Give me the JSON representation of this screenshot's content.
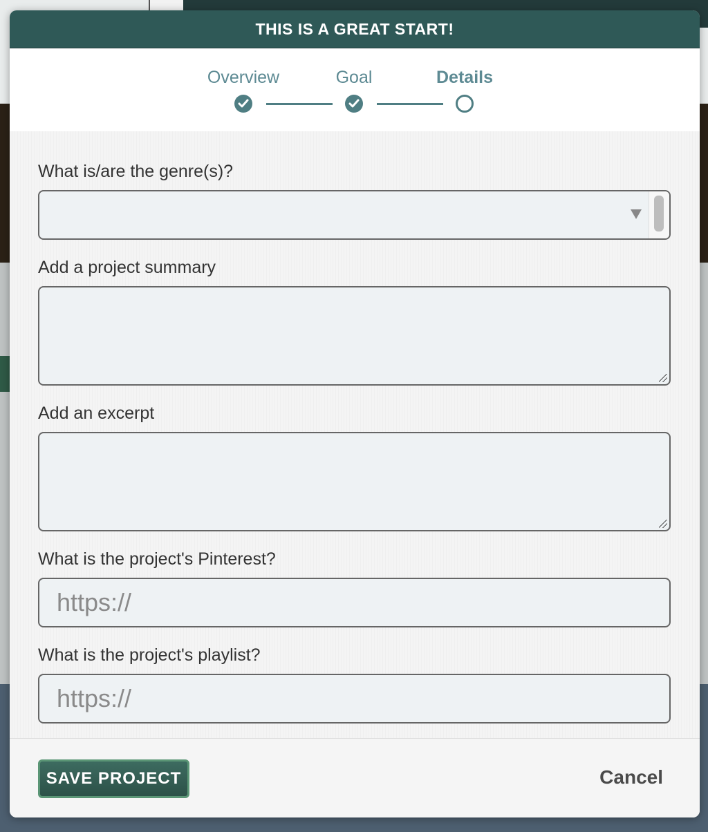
{
  "modal": {
    "title": "THIS IS A GREAT START!"
  },
  "stepper": {
    "steps": [
      {
        "label": "Overview",
        "state": "done"
      },
      {
        "label": "Goal",
        "state": "done"
      },
      {
        "label": "Details",
        "state": "current"
      }
    ]
  },
  "form": {
    "genre_label": "What is/are the genre(s)?",
    "genre_value": "",
    "summary_label": "Add a project summary",
    "summary_value": "",
    "excerpt_label": "Add an excerpt",
    "excerpt_value": "",
    "pinterest_label": "What is the project's Pinterest?",
    "pinterest_placeholder": "https://",
    "playlist_label": "What is the project's playlist?",
    "playlist_placeholder": "https://"
  },
  "footer": {
    "save_label": "SAVE PROJECT",
    "cancel_label": "Cancel"
  },
  "colors": {
    "header_bg": "#2f5957",
    "accent": "#4f7e83",
    "save_button": "#2c5148"
  }
}
